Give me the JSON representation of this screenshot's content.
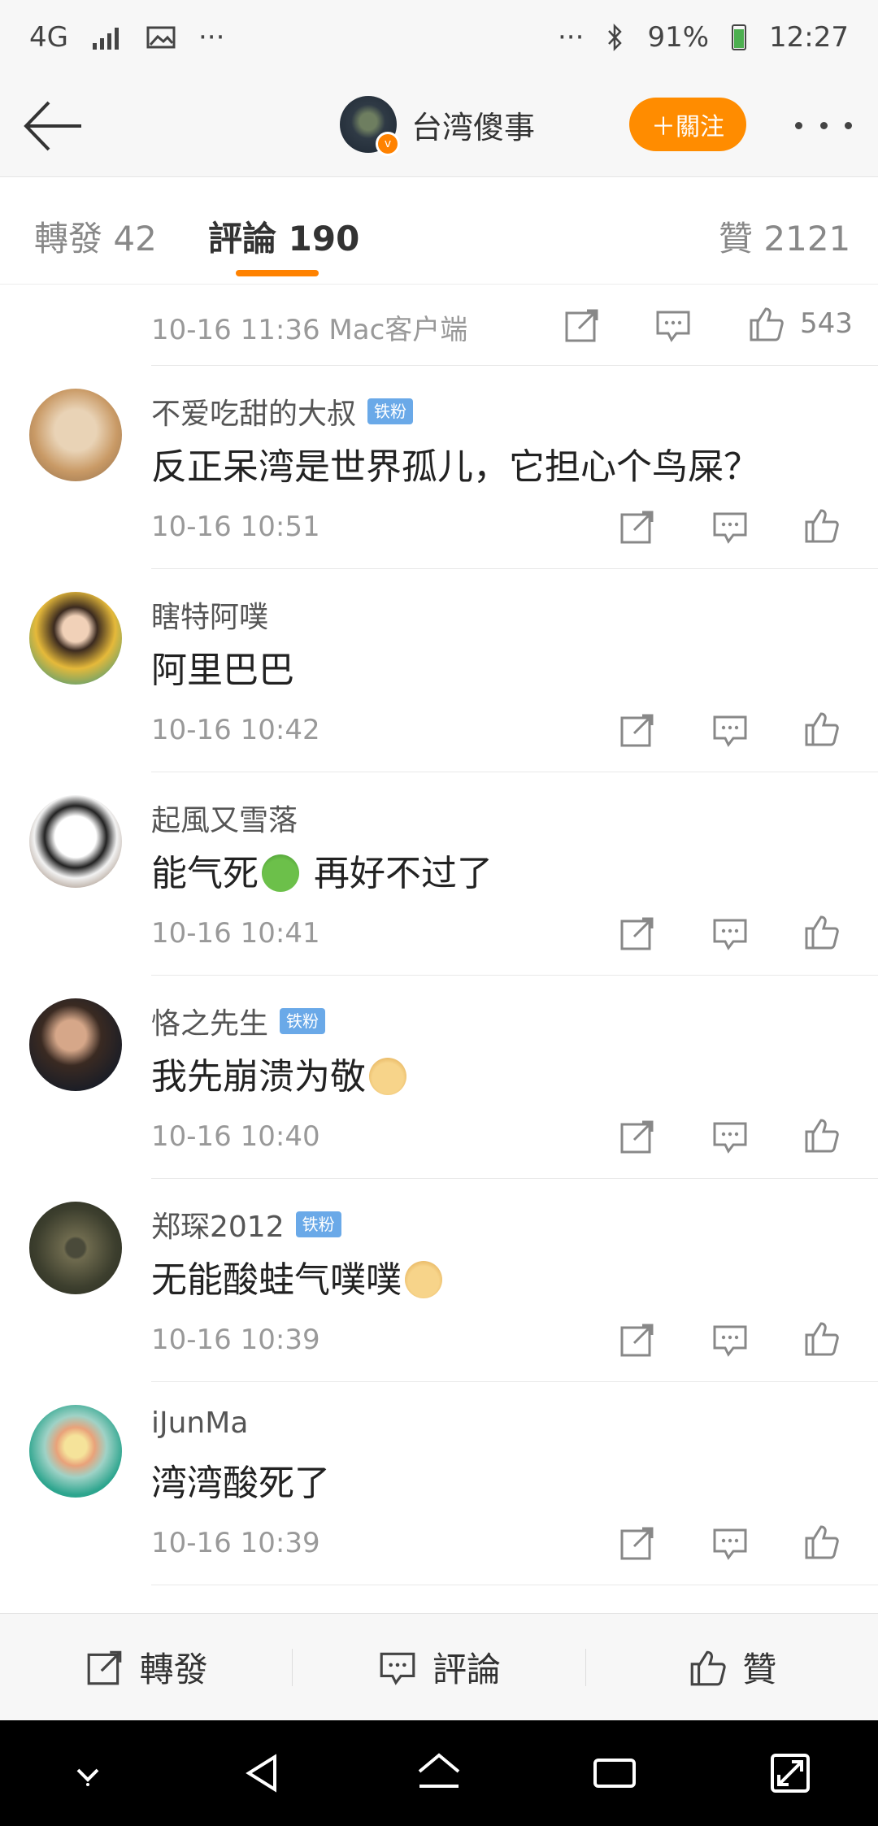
{
  "status_bar": {
    "network": "4G",
    "dots_left": "···",
    "dots_right": "···",
    "battery": "91%",
    "time": "12:27"
  },
  "header": {
    "account_name": "台湾傻事",
    "follow_label": "＋關注",
    "verified_badge": "v"
  },
  "tabs": [
    {
      "label": "轉發",
      "count": "42"
    },
    {
      "label": "評論",
      "count": "190"
    },
    {
      "label": "贊",
      "count": "2121"
    }
  ],
  "post_meta": {
    "time": "10-16 11:36",
    "source": "Mac客户端",
    "likes": "543"
  },
  "comments": [
    {
      "username": "不爱吃甜的大叔",
      "badge": "铁粉",
      "text": "反正呆湾是世界孤儿，它担心个鸟屎？",
      "time": "10-16 10:51"
    },
    {
      "username": "瞎特阿噗",
      "badge": "",
      "text": "阿里巴巴",
      "time": "10-16 10:42"
    },
    {
      "username": "起風又雪落",
      "badge": "",
      "text_before": "能气死",
      "text_after": " 再好不过了",
      "time": "10-16 10:41"
    },
    {
      "username": "恪之先生",
      "badge": "铁粉",
      "text": "我先崩溃为敬",
      "time": "10-16 10:40"
    },
    {
      "username": "郑琛2012",
      "badge": "铁粉",
      "text": "无能酸蛙气噗噗",
      "time": "10-16 10:39"
    },
    {
      "username": "iJunMa",
      "badge": "",
      "text": "湾湾酸死了",
      "time": "10-16 10:39"
    }
  ],
  "bottom_bar": {
    "repost": "轉發",
    "comment": "評論",
    "like": "贊"
  },
  "colors": {
    "accent": "#ff8200",
    "badge": "#6aa9e8"
  }
}
